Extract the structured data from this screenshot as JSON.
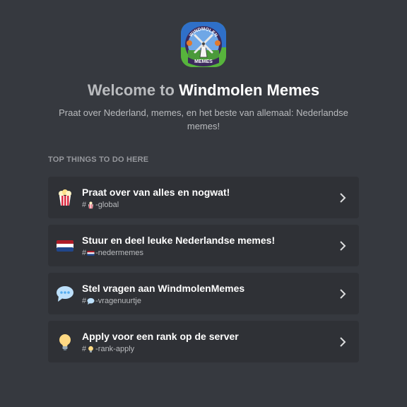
{
  "server": {
    "icon_name": "windmill-server-icon",
    "logo_text_top": "WINDMOLEN",
    "logo_text_bottom": "MEMES"
  },
  "welcome": {
    "prefix": "Welcome to",
    "server_name": "Windmolen Memes",
    "description": "Praat over Nederland, memes, en het beste van allemaal: Nederlandse memes!"
  },
  "section_heading": "TOP THINGS TO DO HERE",
  "items": [
    {
      "icon": "popcorn-icon",
      "title": "Praat over van alles en nogwat!",
      "channel_prefix": "#",
      "channel_emoji": "popcorn-icon",
      "channel_name": "-global"
    },
    {
      "icon": "netherlands-flag-icon",
      "title": "Stuur en deel leuke Nederlandse memes!",
      "channel_prefix": "#",
      "channel_emoji": "netherlands-flag-icon",
      "channel_name": "-nedermemes"
    },
    {
      "icon": "speech-balloon-icon",
      "title": "Stel vragen aan WindmolenMemes",
      "channel_prefix": "#",
      "channel_emoji": "speech-balloon-icon",
      "channel_name": "-vragenuurtje"
    },
    {
      "icon": "light-bulb-icon",
      "title": "Apply voor een rank op de server",
      "channel_prefix": "#",
      "channel_emoji": "light-bulb-icon",
      "channel_name": "-rank-apply"
    }
  ],
  "colors": {
    "background": "#36393f",
    "card": "#2f3136",
    "title_white": "#ffffff",
    "muted_text": "#b9bbbe",
    "heading_gray": "#96989d"
  }
}
